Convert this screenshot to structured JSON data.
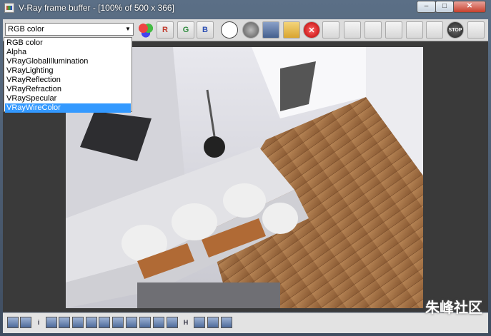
{
  "window": {
    "title": "V-Ray frame buffer - [100% of 500 x 366]",
    "minimize_glyph": "–",
    "maximize_glyph": "□",
    "close_glyph": "✕"
  },
  "toolbar": {
    "channel_select": {
      "selected": "RGB color"
    },
    "buttons": [
      {
        "name": "rgb-channels-icon",
        "label": ""
      },
      {
        "name": "red-channel-button",
        "label": "R",
        "color": "#c0392b"
      },
      {
        "name": "green-channel-button",
        "label": "G",
        "color": "#2e8b3e"
      },
      {
        "name": "blue-channel-button",
        "label": "B",
        "color": "#2c4fb3"
      },
      {
        "name": "mono-mode-icon",
        "label": ""
      },
      {
        "name": "alpha-icon",
        "label": ""
      },
      {
        "name": "save-icon",
        "label": ""
      },
      {
        "name": "open-folder-icon",
        "label": ""
      },
      {
        "name": "clear-icon",
        "label": ""
      },
      {
        "name": "duplicate-to-mpf-icon",
        "label": ""
      },
      {
        "name": "track-mouse-icon",
        "label": ""
      },
      {
        "name": "render-last-icon",
        "label": ""
      },
      {
        "name": "vfb-history-icon",
        "label": ""
      },
      {
        "name": "region-render-icon",
        "label": ""
      },
      {
        "name": "link-icon",
        "label": ""
      },
      {
        "name": "stop-icon",
        "label": "STOP"
      },
      {
        "name": "teapot-icon",
        "label": ""
      }
    ]
  },
  "channel_dropdown": {
    "options": [
      "RGB color",
      "Alpha",
      "VRayGlobalIllumination",
      "VRayLighting",
      "VRayReflection",
      "VRayRefraction",
      "VRaySpecular",
      "VRayWireColor"
    ],
    "highlighted": "VRayWireColor"
  },
  "statusbar": {
    "buttons": [
      {
        "name": "display-correction-icon",
        "label": ""
      },
      {
        "name": "info-list-icon",
        "label": ""
      },
      {
        "name": "info-icon",
        "label": "i"
      },
      {
        "name": "levels-icon",
        "label": ""
      },
      {
        "name": "hsl-icon",
        "label": ""
      },
      {
        "name": "color-balance-icon",
        "label": ""
      },
      {
        "name": "histogram-icon",
        "label": ""
      },
      {
        "name": "curve-icon",
        "label": ""
      },
      {
        "name": "exposure-icon",
        "label": ""
      },
      {
        "name": "lut-icon",
        "label": ""
      },
      {
        "name": "lens-effects-icon",
        "label": ""
      },
      {
        "name": "stamp-icon",
        "label": ""
      },
      {
        "name": "pixel-aspect-icon",
        "label": ""
      },
      {
        "name": "horizontal-flip-icon",
        "label": "H"
      },
      {
        "name": "compare-icon",
        "label": ""
      },
      {
        "name": "ab-compare-icon",
        "label": ""
      },
      {
        "name": "close-status-icon",
        "label": ""
      }
    ],
    "watermark": "朱峰社区"
  }
}
